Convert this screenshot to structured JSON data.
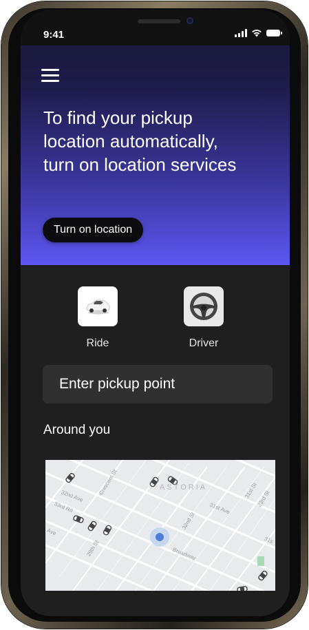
{
  "status_bar": {
    "time": "9:41"
  },
  "hero": {
    "title": "To find your pickup location automatically, turn on location services",
    "button_label": "Turn on location",
    "gradient_start": "#161630",
    "gradient_end": "#5d56f2"
  },
  "options": [
    {
      "label": "Ride",
      "icon": "car-icon"
    },
    {
      "label": "Driver",
      "icon": "steering-wheel-icon"
    }
  ],
  "pickup": {
    "placeholder": "Enter pickup point"
  },
  "around": {
    "title": "Around you"
  },
  "map": {
    "neighborhood": "ASTORIA",
    "streets": [
      "32nd Ave",
      "33rd Rd",
      "Crescent St",
      "31st Ave",
      "32nd St",
      "29th St",
      "Broadway",
      "31st St",
      "23rd St",
      "Ave",
      "31s"
    ]
  }
}
